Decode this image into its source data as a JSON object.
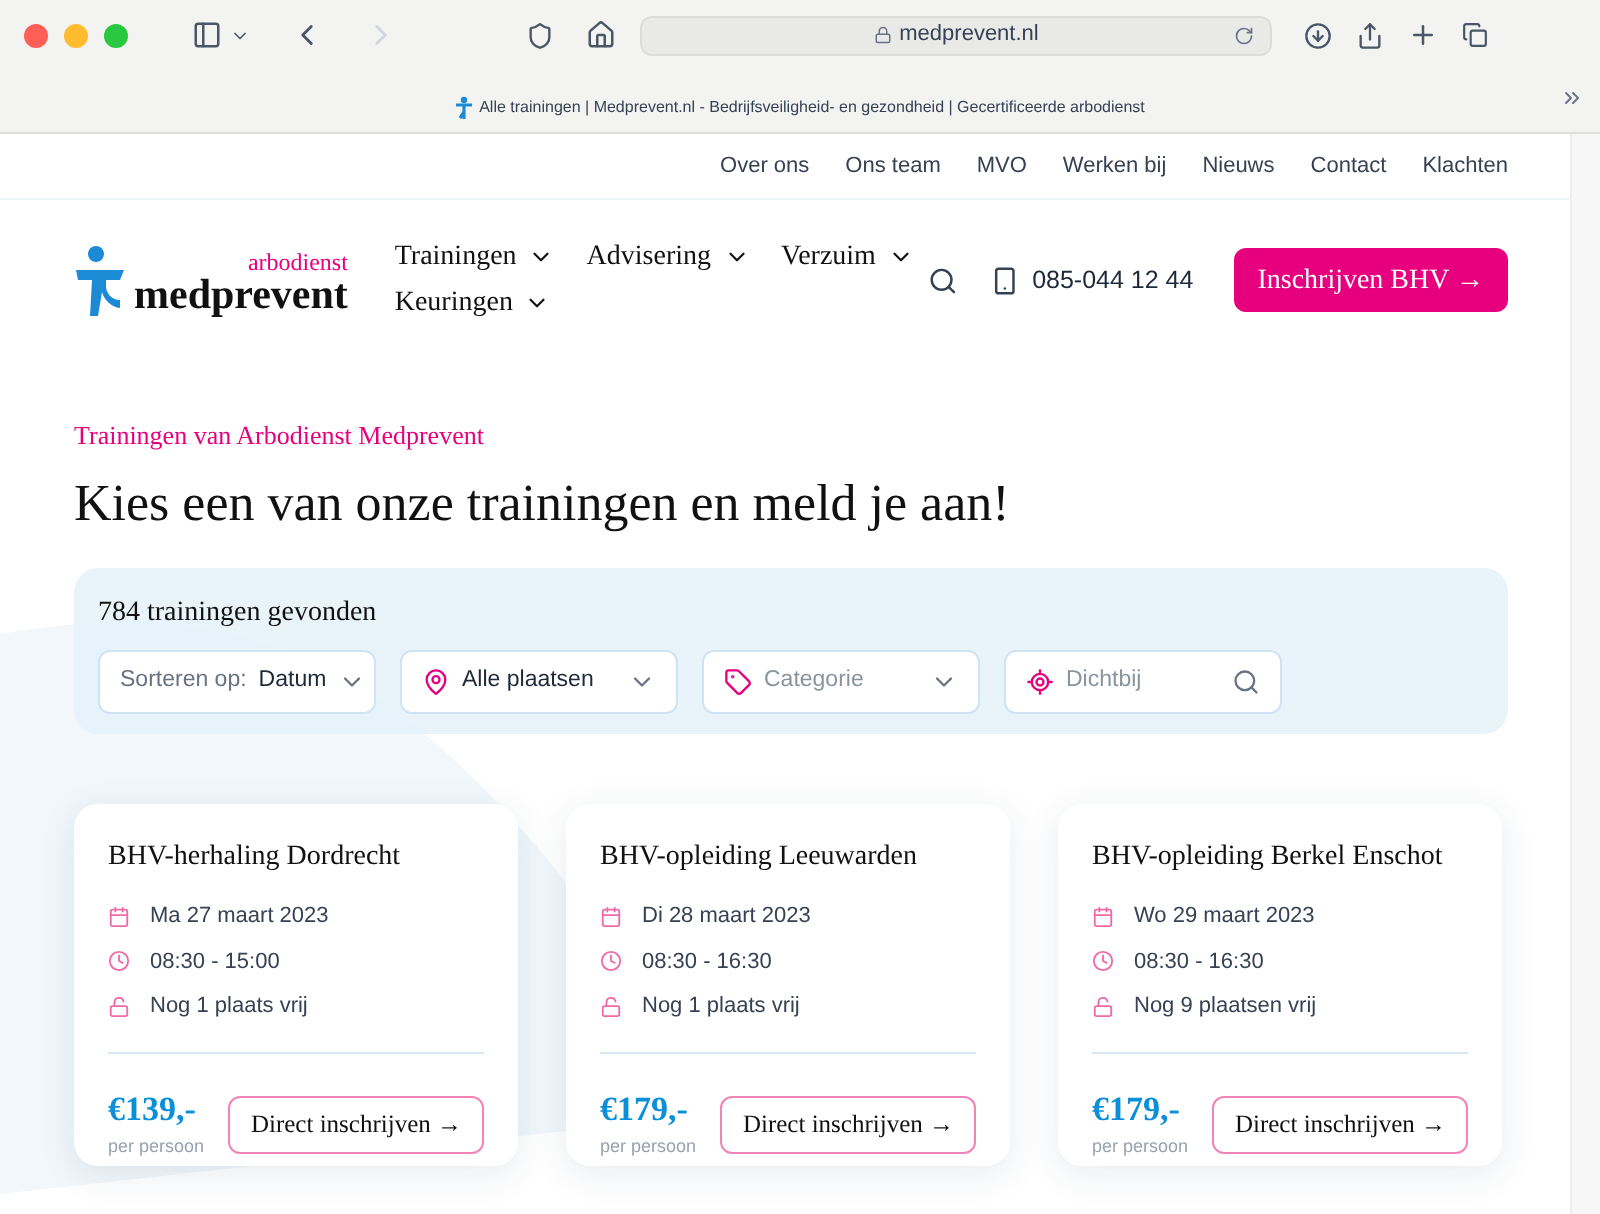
{
  "browser": {
    "url": "medprevent.nl",
    "tab_title": "Alle trainingen | Medprevent.nl - Bedrijfsveiligheid- en gezondheid | Gecertificeerde arbodienst"
  },
  "top_nav": [
    "Over ons",
    "Ons team",
    "MVO",
    "Werken bij",
    "Nieuws",
    "Contact",
    "Klachten"
  ],
  "logo": {
    "tagline": "arbodienst",
    "name": "medprevent"
  },
  "main_nav": [
    "Trainingen",
    "Advisering",
    "Verzuim",
    "Keuringen"
  ],
  "phone": "085-044 12 44",
  "cta": "Inschrijven BHV →",
  "eyebrow": "Trainingen van Arbodienst Medprevent",
  "heading": "Kies een van onze trainingen en meld je aan!",
  "results": "784 trainingen gevonden",
  "filters": [
    {
      "kind": "sort",
      "label": "Sorteren op:",
      "value": "Datum"
    },
    {
      "kind": "place",
      "value": "Alle plaatsen"
    },
    {
      "kind": "category",
      "placeholder": "Categorie"
    },
    {
      "kind": "nearby",
      "placeholder": "Dichtbij"
    }
  ],
  "cards": [
    {
      "title": "BHV-herhaling Dordrecht",
      "date": "Ma 27 maart 2023",
      "time": "08:30 - 15:00",
      "seats": "Nog 1 plaats vrij",
      "price": "€139,-",
      "price_note": "per persoon",
      "button": "Direct inschrijven →"
    },
    {
      "title": "BHV-opleiding Leeuwarden",
      "date": "Di 28 maart 2023",
      "time": "08:30 - 16:30",
      "seats": "Nog 1 plaats vrij",
      "price": "€179,-",
      "price_note": "per persoon",
      "button": "Direct inschrijven →"
    },
    {
      "title": "BHV-opleiding Berkel Enschot",
      "date": "Wo 29 maart 2023",
      "time": "08:30 - 16:30",
      "seats": "Nog 9 plaatsen vrij",
      "price": "€179,-",
      "price_note": "per persoon",
      "button": "Direct inschrijven →"
    }
  ]
}
